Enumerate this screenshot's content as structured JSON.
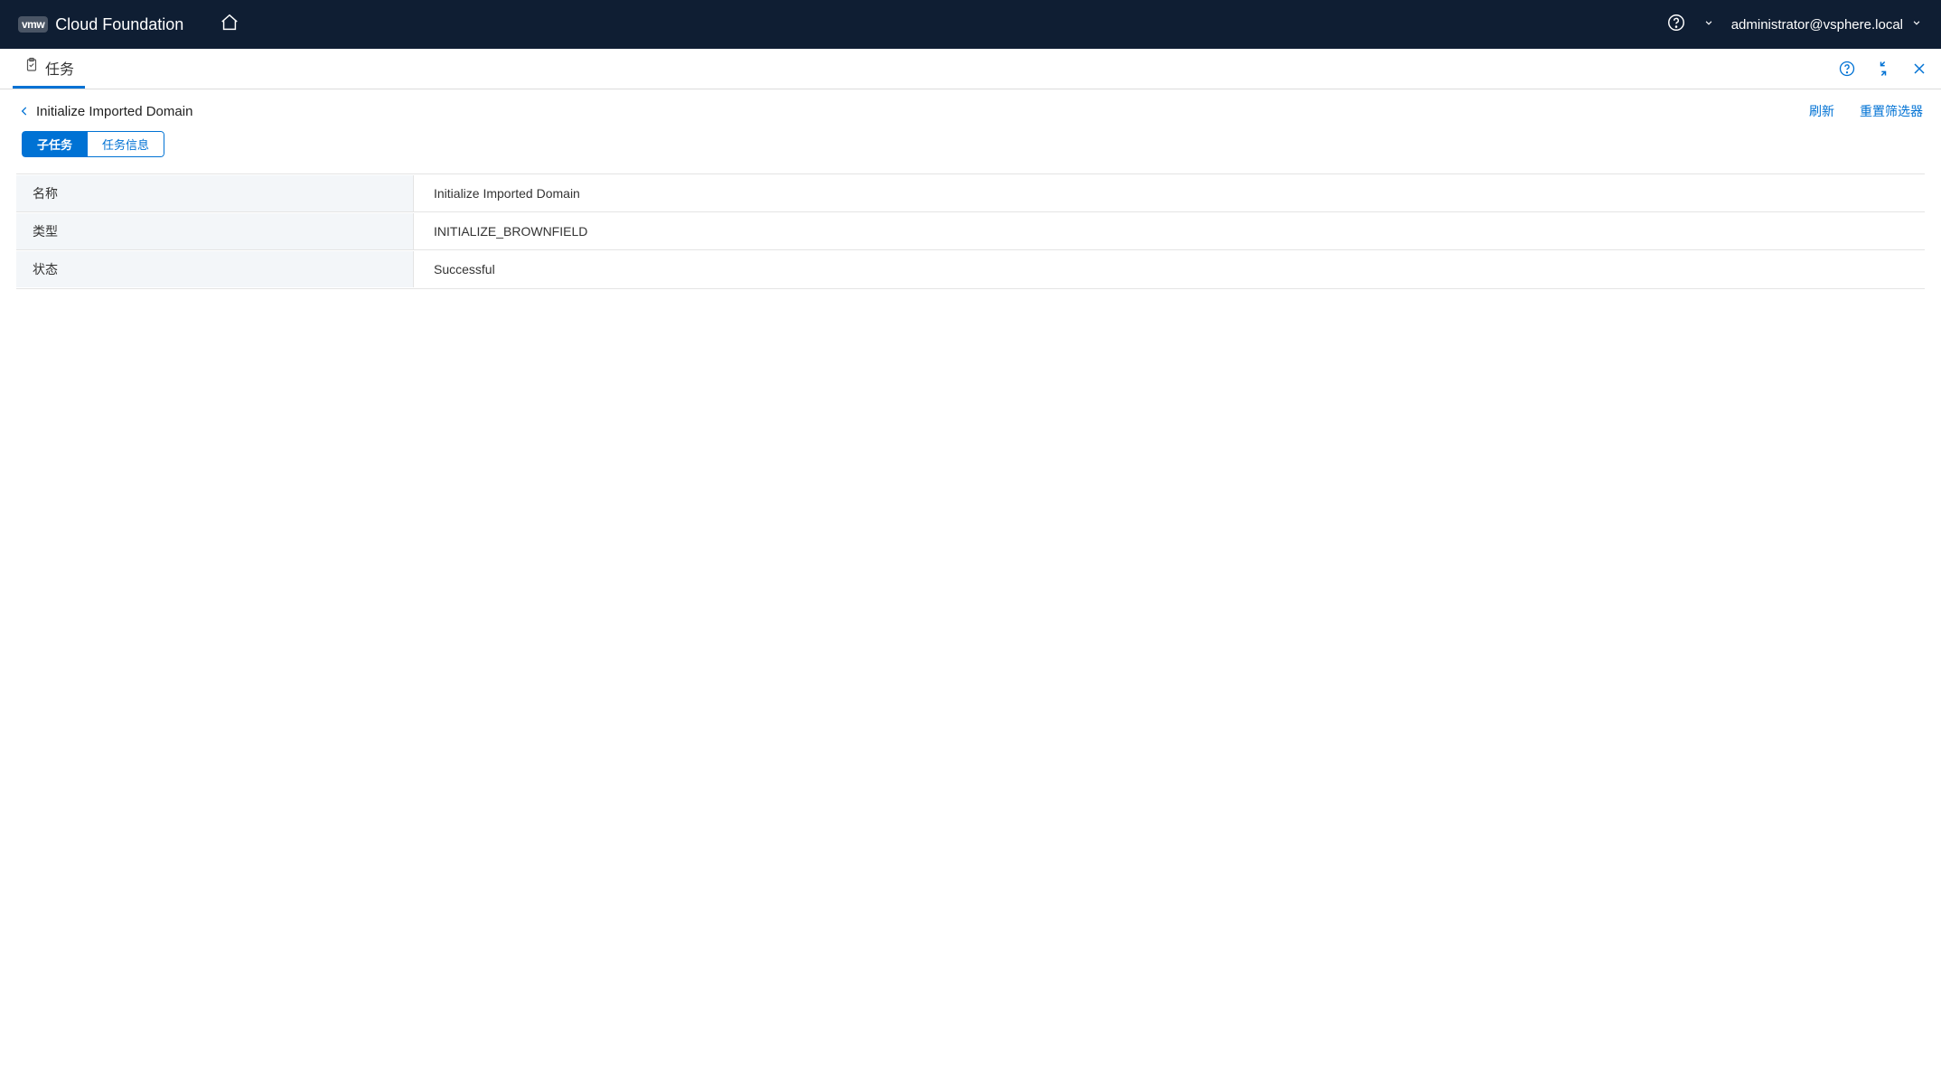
{
  "header": {
    "brand_badge": "vmw",
    "brand_title": "Cloud Foundation",
    "user": "administrator@vsphere.local"
  },
  "subheader": {
    "tab_label": "任务"
  },
  "breadcrumb": {
    "title": "Initialize Imported Domain",
    "refresh": "刷新",
    "reset_filters": "重置筛选器"
  },
  "segmented": {
    "sub_tasks": "子任务",
    "task_info": "任务信息"
  },
  "details": {
    "rows": [
      {
        "label": "名称",
        "value": "Initialize Imported Domain"
      },
      {
        "label": "类型",
        "value": "INITIALIZE_BROWNFIELD"
      },
      {
        "label": "状态",
        "value": "Successful"
      }
    ]
  }
}
